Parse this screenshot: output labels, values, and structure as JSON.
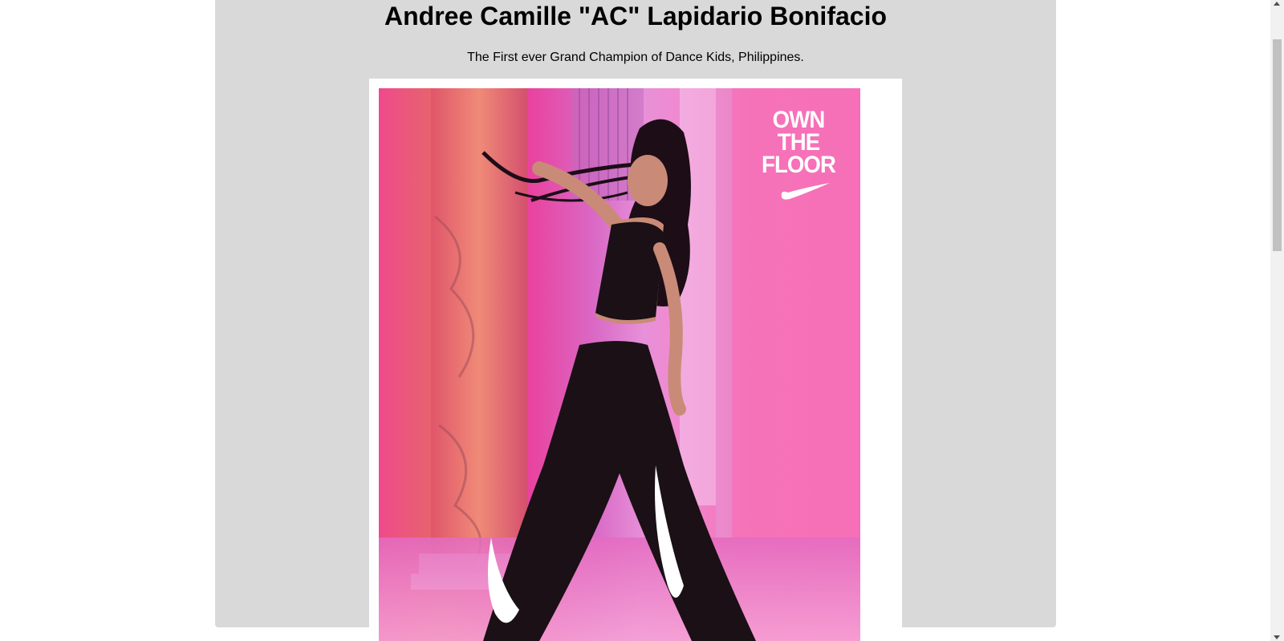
{
  "page": {
    "title": "Andree Camille \"AC\" Lapidario Bonifacio",
    "subtitle": "The First ever Grand Champion of Dance Kids, Philippines."
  },
  "photo": {
    "slogan_lines": [
      "OWN",
      "THE",
      "FLOOR"
    ],
    "logo": "swoosh-logo"
  },
  "colors": {
    "panel_background": "#d9d9d9",
    "page_background": "#ffffff",
    "photo_pink": "#f573b9"
  }
}
